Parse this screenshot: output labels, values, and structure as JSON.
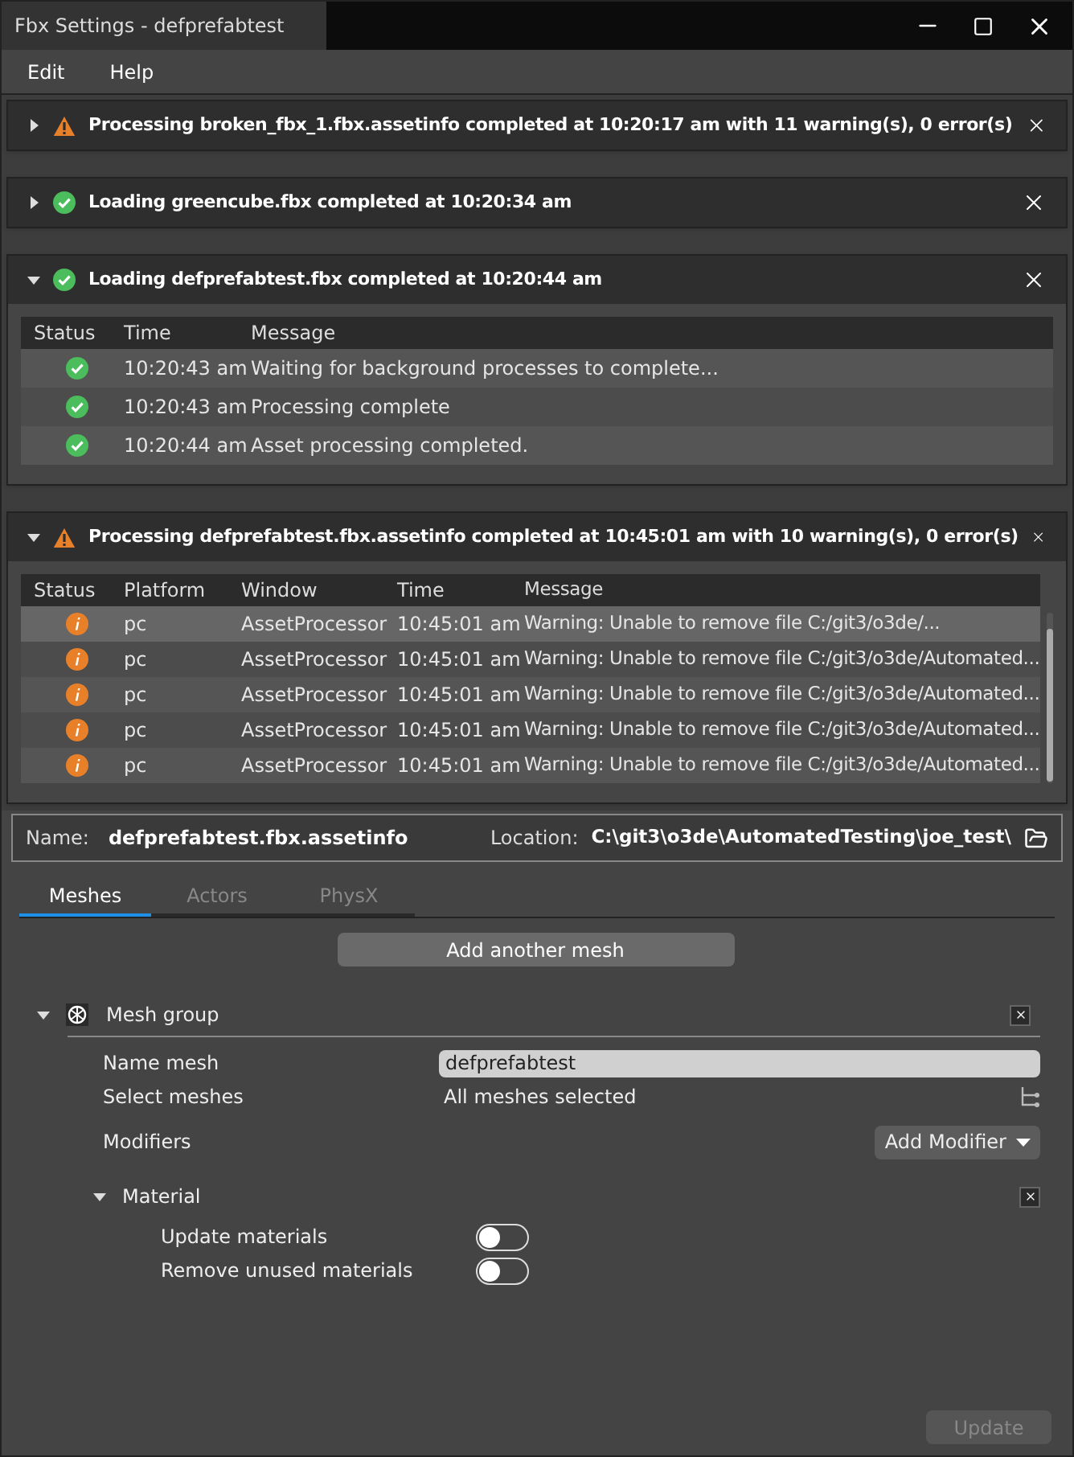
{
  "window": {
    "title": "Fbx Settings - defprefabtest"
  },
  "menu": [
    "Edit",
    "Help"
  ],
  "notifications": [
    {
      "kind": "warning",
      "expanded": false,
      "title": "Processing broken_fbx_1.fbx.assetinfo completed at 10:20:17 am with 11 warning(s), 0 error(s)"
    },
    {
      "kind": "success",
      "expanded": false,
      "title": "Loading greencube.fbx completed at 10:20:34 am"
    },
    {
      "kind": "success",
      "expanded": true,
      "title": "Loading defprefabtest.fbx completed at 10:20:44 am",
      "columns": [
        "Status",
        "Time",
        "Message"
      ],
      "rows": [
        {
          "kind": "success",
          "selected": false,
          "cells": [
            "",
            "10:20:43 am",
            "Waiting for background processes to complete..."
          ]
        },
        {
          "kind": "success",
          "selected": false,
          "cells": [
            "",
            "10:20:43 am",
            "Processing complete"
          ]
        },
        {
          "kind": "success",
          "selected": false,
          "cells": [
            "",
            "10:20:44 am",
            "Asset processing completed."
          ]
        }
      ]
    },
    {
      "kind": "warning",
      "expanded": true,
      "title": "Processing defprefabtest.fbx.assetinfo completed at 10:45:01 am with 10 warning(s), 0 error(s)",
      "columns": [
        "Status",
        "Platform",
        "Window",
        "Time",
        "Message"
      ],
      "rows": [
        {
          "kind": "info",
          "selected": true,
          "cells": [
            "",
            "pc",
            "AssetProcessor",
            "10:45:01 am",
            "Warning: Unable to remove file C:/git3/o3de/..."
          ]
        },
        {
          "kind": "info",
          "selected": false,
          "cells": [
            "",
            "pc",
            "AssetProcessor",
            "10:45:01 am",
            "Warning: Unable to remove file C:/git3/o3de/Automated..."
          ]
        },
        {
          "kind": "info",
          "selected": false,
          "cells": [
            "",
            "pc",
            "AssetProcessor",
            "10:45:01 am",
            "Warning: Unable to remove file C:/git3/o3de/Automated..."
          ]
        },
        {
          "kind": "info",
          "selected": false,
          "cells": [
            "",
            "pc",
            "AssetProcessor",
            "10:45:01 am",
            "Warning: Unable to remove file C:/git3/o3de/Automated..."
          ]
        },
        {
          "kind": "info",
          "selected": false,
          "cells": [
            "",
            "pc",
            "AssetProcessor",
            "10:45:01 am",
            "Warning: Unable to remove file C:/git3/o3de/Automated..."
          ]
        }
      ]
    }
  ],
  "file": {
    "name_label": "Name:",
    "name": "defprefabtest.fbx.assetinfo",
    "location_label": "Location:",
    "location": "C:\\git3\\o3de\\AutomatedTesting\\joe_test\\"
  },
  "tabs": [
    {
      "label": "Meshes",
      "selected": true
    },
    {
      "label": "Actors",
      "selected": false
    },
    {
      "label": "PhysX",
      "selected": false
    }
  ],
  "add_mesh_button": "Add another mesh",
  "mesh_group": {
    "title": "Mesh group",
    "expanded": true,
    "name_label": "Name mesh",
    "name_value": "defprefabtest",
    "select_label": "Select meshes",
    "select_value": "All meshes selected",
    "modifiers_label": "Modifiers",
    "add_modifier_button": "Add Modifier",
    "material": {
      "title": "Material",
      "expanded": true,
      "options": [
        {
          "label": "Update materials",
          "on": false
        },
        {
          "label": "Remove unused materials",
          "on": false
        }
      ]
    }
  },
  "update_button": {
    "label": "Update",
    "disabled": true
  }
}
